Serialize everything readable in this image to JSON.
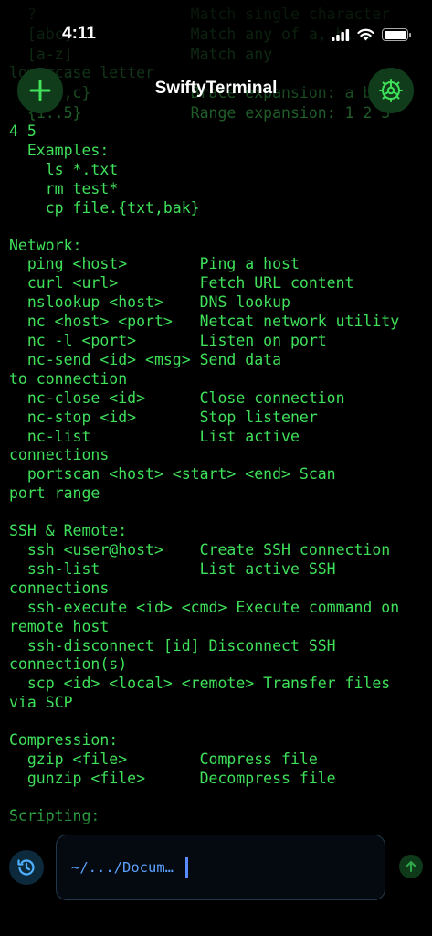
{
  "status_bar": {
    "time": "4:11"
  },
  "nav": {
    "title": "SwiftyTerminal",
    "add_icon": "plus-icon",
    "settings_icon": "gear-icon"
  },
  "terminal": {
    "background_lines": [
      "  ?                 Match single character",
      "  [abc]             Match any of a, b, c",
      "  [a-z]             Match any",
      "lowercase letter",
      "  {a,b,c}           Brace expansion: a b c",
      "  {1..5}            Range expansion: 1 2 3"
    ],
    "lines": [
      "4 5",
      "  Examples:",
      "    ls *.txt",
      "    rm test*",
      "    cp file.{txt,bak}",
      "",
      "Network:",
      "  ping <host>        Ping a host",
      "  curl <url>         Fetch URL content",
      "  nslookup <host>    DNS lookup",
      "  nc <host> <port>   Netcat network utility",
      "  nc -l <port>       Listen on port",
      "  nc-send <id> <msg> Send data",
      "to connection",
      "  nc-close <id>      Close connection",
      "  nc-stop <id>       Stop listener",
      "  nc-list            List active",
      "connections",
      "  portscan <host> <start> <end> Scan",
      "port range",
      "",
      "SSH & Remote:",
      "  ssh <user@host>    Create SSH connection",
      "  ssh-list           List active SSH",
      "connections",
      "  ssh-execute <id> <cmd> Execute command on",
      "remote host",
      "  ssh-disconnect [id] Disconnect SSH",
      "connection(s)",
      "  scp <id> <local> <remote> Transfer files",
      "via SCP",
      "",
      "Compression:",
      "  gzip <file>        Compress file",
      "  gunzip <file>      Decompress file",
      "",
      "Scripting:"
    ]
  },
  "input": {
    "prompt": "~/.../Docum…",
    "history_icon": "history-icon",
    "send_icon": "arrow-up-icon"
  },
  "colors": {
    "terminal_text": "#3fe05a",
    "prompt": "#5aa0ff",
    "button_bg": "#113c1c"
  }
}
